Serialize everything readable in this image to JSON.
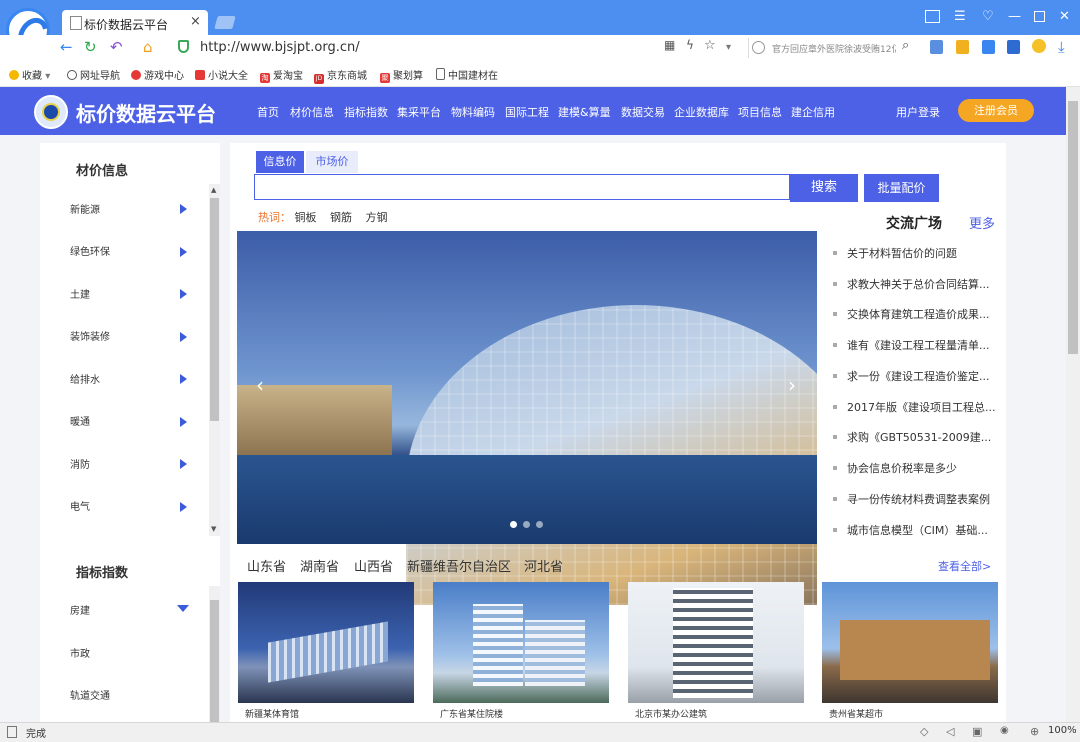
{
  "browser": {
    "tab_title": "标价数据云平台",
    "tab_close": "×",
    "url": "http://www.bjsjpt.org.cn/",
    "search_placeholder": "官方回应章外医院徐波受贿12亿",
    "status": "完成",
    "zoom": "100%",
    "bookmarks": [
      "收藏",
      "网址导航",
      "游戏中心",
      "小说大全",
      "爱淘宝",
      "京东商城",
      "聚划算",
      "中国建材在"
    ],
    "bookmark_icons": {
      "dup": "淘",
      "jd": "JD",
      "ju": "聚"
    },
    "bookmark_dropdown": "▾"
  },
  "site": {
    "title": "标价数据云平台",
    "nav": [
      "首页",
      "材价信息",
      "指标指数",
      "集采平台",
      "物料编码",
      "国际工程",
      "建模&算量",
      "数据交易",
      "企业数据库",
      "项目信息",
      "建企信用"
    ],
    "user_login": "用户登录",
    "register": "注册会员",
    "accent": "#4d61e6",
    "register_color": "#f5a623"
  },
  "sidebar": {
    "material_head": "材价信息",
    "material_items": [
      "新能源",
      "绿色环保",
      "土建",
      "装饰装修",
      "给排水",
      "暖通",
      "消防",
      "电气"
    ],
    "index_head": "指标指数",
    "index_items": [
      "房建",
      "市政",
      "轨道交通"
    ]
  },
  "search": {
    "tabs": [
      "信息价",
      "市场价"
    ],
    "button": "搜索",
    "batch_button": "批量配价",
    "hot_label": "热词：",
    "hot_words": [
      "铜板",
      "钢筋",
      "方钢"
    ]
  },
  "banner": {
    "prev": "‹",
    "next": "›"
  },
  "exchange": {
    "title": "交流广场",
    "more": "更多",
    "items": [
      "关于材料暂估价的问题",
      "求教大神关于总价合同结算...",
      "交换体育建筑工程造价成果...",
      "谁有《建设工程工程量清单...",
      "求一份《建设工程造价鉴定...",
      "2017年版《建设项目工程总...",
      "求购《GBT50531-2009建...",
      "协会信息价税率是多少",
      "寻一份传统材料费调整表案例",
      "城市信息模型（CIM）基础..."
    ]
  },
  "provinces": {
    "tabs": [
      "山东省",
      "湖南省",
      "山西省",
      "新疆维吾尔自治区",
      "河北省"
    ],
    "view_all": "查看全部>",
    "cards": [
      "新疆某体育馆",
      "广东省某住院楼",
      "北京市某办公建筑",
      "贵州省某超市"
    ]
  }
}
